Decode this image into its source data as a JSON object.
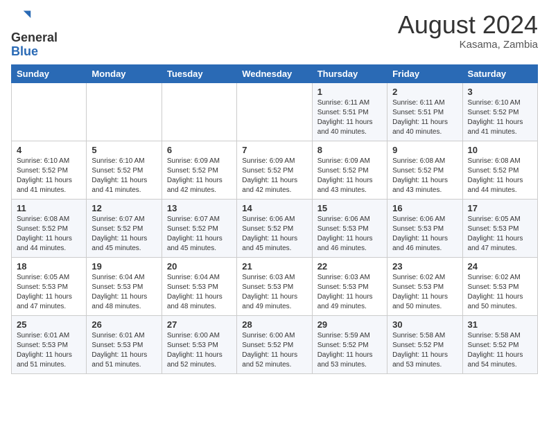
{
  "header": {
    "logo_general": "General",
    "logo_blue": "Blue",
    "month_year": "August 2024",
    "location": "Kasama, Zambia"
  },
  "days_of_week": [
    "Sunday",
    "Monday",
    "Tuesday",
    "Wednesday",
    "Thursday",
    "Friday",
    "Saturday"
  ],
  "weeks": [
    [
      {
        "num": "",
        "info": ""
      },
      {
        "num": "",
        "info": ""
      },
      {
        "num": "",
        "info": ""
      },
      {
        "num": "",
        "info": ""
      },
      {
        "num": "1",
        "info": "Sunrise: 6:11 AM\nSunset: 5:51 PM\nDaylight: 11 hours\nand 40 minutes."
      },
      {
        "num": "2",
        "info": "Sunrise: 6:11 AM\nSunset: 5:51 PM\nDaylight: 11 hours\nand 40 minutes."
      },
      {
        "num": "3",
        "info": "Sunrise: 6:10 AM\nSunset: 5:52 PM\nDaylight: 11 hours\nand 41 minutes."
      }
    ],
    [
      {
        "num": "4",
        "info": "Sunrise: 6:10 AM\nSunset: 5:52 PM\nDaylight: 11 hours\nand 41 minutes."
      },
      {
        "num": "5",
        "info": "Sunrise: 6:10 AM\nSunset: 5:52 PM\nDaylight: 11 hours\nand 41 minutes."
      },
      {
        "num": "6",
        "info": "Sunrise: 6:09 AM\nSunset: 5:52 PM\nDaylight: 11 hours\nand 42 minutes."
      },
      {
        "num": "7",
        "info": "Sunrise: 6:09 AM\nSunset: 5:52 PM\nDaylight: 11 hours\nand 42 minutes."
      },
      {
        "num": "8",
        "info": "Sunrise: 6:09 AM\nSunset: 5:52 PM\nDaylight: 11 hours\nand 43 minutes."
      },
      {
        "num": "9",
        "info": "Sunrise: 6:08 AM\nSunset: 5:52 PM\nDaylight: 11 hours\nand 43 minutes."
      },
      {
        "num": "10",
        "info": "Sunrise: 6:08 AM\nSunset: 5:52 PM\nDaylight: 11 hours\nand 44 minutes."
      }
    ],
    [
      {
        "num": "11",
        "info": "Sunrise: 6:08 AM\nSunset: 5:52 PM\nDaylight: 11 hours\nand 44 minutes."
      },
      {
        "num": "12",
        "info": "Sunrise: 6:07 AM\nSunset: 5:52 PM\nDaylight: 11 hours\nand 45 minutes."
      },
      {
        "num": "13",
        "info": "Sunrise: 6:07 AM\nSunset: 5:52 PM\nDaylight: 11 hours\nand 45 minutes."
      },
      {
        "num": "14",
        "info": "Sunrise: 6:06 AM\nSunset: 5:52 PM\nDaylight: 11 hours\nand 45 minutes."
      },
      {
        "num": "15",
        "info": "Sunrise: 6:06 AM\nSunset: 5:53 PM\nDaylight: 11 hours\nand 46 minutes."
      },
      {
        "num": "16",
        "info": "Sunrise: 6:06 AM\nSunset: 5:53 PM\nDaylight: 11 hours\nand 46 minutes."
      },
      {
        "num": "17",
        "info": "Sunrise: 6:05 AM\nSunset: 5:53 PM\nDaylight: 11 hours\nand 47 minutes."
      }
    ],
    [
      {
        "num": "18",
        "info": "Sunrise: 6:05 AM\nSunset: 5:53 PM\nDaylight: 11 hours\nand 47 minutes."
      },
      {
        "num": "19",
        "info": "Sunrise: 6:04 AM\nSunset: 5:53 PM\nDaylight: 11 hours\nand 48 minutes."
      },
      {
        "num": "20",
        "info": "Sunrise: 6:04 AM\nSunset: 5:53 PM\nDaylight: 11 hours\nand 48 minutes."
      },
      {
        "num": "21",
        "info": "Sunrise: 6:03 AM\nSunset: 5:53 PM\nDaylight: 11 hours\nand 49 minutes."
      },
      {
        "num": "22",
        "info": "Sunrise: 6:03 AM\nSunset: 5:53 PM\nDaylight: 11 hours\nand 49 minutes."
      },
      {
        "num": "23",
        "info": "Sunrise: 6:02 AM\nSunset: 5:53 PM\nDaylight: 11 hours\nand 50 minutes."
      },
      {
        "num": "24",
        "info": "Sunrise: 6:02 AM\nSunset: 5:53 PM\nDaylight: 11 hours\nand 50 minutes."
      }
    ],
    [
      {
        "num": "25",
        "info": "Sunrise: 6:01 AM\nSunset: 5:53 PM\nDaylight: 11 hours\nand 51 minutes."
      },
      {
        "num": "26",
        "info": "Sunrise: 6:01 AM\nSunset: 5:53 PM\nDaylight: 11 hours\nand 51 minutes."
      },
      {
        "num": "27",
        "info": "Sunrise: 6:00 AM\nSunset: 5:53 PM\nDaylight: 11 hours\nand 52 minutes."
      },
      {
        "num": "28",
        "info": "Sunrise: 6:00 AM\nSunset: 5:52 PM\nDaylight: 11 hours\nand 52 minutes."
      },
      {
        "num": "29",
        "info": "Sunrise: 5:59 AM\nSunset: 5:52 PM\nDaylight: 11 hours\nand 53 minutes."
      },
      {
        "num": "30",
        "info": "Sunrise: 5:58 AM\nSunset: 5:52 PM\nDaylight: 11 hours\nand 53 minutes."
      },
      {
        "num": "31",
        "info": "Sunrise: 5:58 AM\nSunset: 5:52 PM\nDaylight: 11 hours\nand 54 minutes."
      }
    ]
  ]
}
